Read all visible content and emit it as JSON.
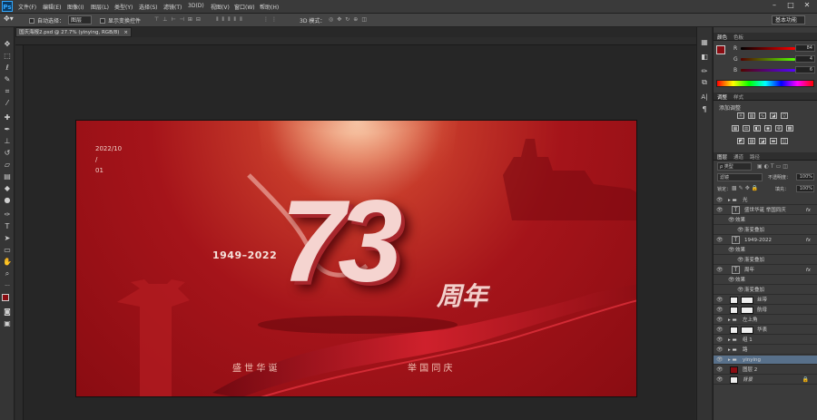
{
  "menubar": {
    "logo": "Ps",
    "items": [
      "文件(F)",
      "编辑(E)",
      "图像(I)",
      "图层(L)",
      "类型(Y)",
      "选择(S)",
      "滤镜(T)",
      "3D(D)",
      "视图(V)",
      "窗口(W)",
      "帮助(H)"
    ],
    "window_buttons": [
      "–",
      "□",
      "✕"
    ]
  },
  "optionsbar": {
    "auto_select_label": "自动选择：",
    "auto_select_value": "图层",
    "show_transform_label": "显示变换控件",
    "mode_3d_label": "3D 模式：",
    "workspace": "基本功能"
  },
  "document": {
    "tab_title": "国庆海报2.psd @ 27.7% (yinying, RGB/8)",
    "close": "×"
  },
  "poster": {
    "date_line1": "2022/10",
    "date_line2": "/",
    "date_line3": "01",
    "years": "1949–2022",
    "big_number": "73",
    "suffix": "周年",
    "slogan_left": "盛 世 华 诞",
    "slogan_right": "举 国 同 庆"
  },
  "color_panel": {
    "tab_active": "颜色",
    "tab_other": "色板",
    "r_label": "R",
    "r_value": "84",
    "g_label": "G",
    "g_value": "4",
    "b_label": "B",
    "b_value": "6"
  },
  "adjust_panel": {
    "tab_active": "调整",
    "tab_other": "样式",
    "title": "添加调整"
  },
  "layers_panel": {
    "tabs": [
      "图层",
      "通道",
      "路径"
    ],
    "filter_label": "ρ 类型",
    "blend_mode": "滤镜",
    "opacity_label": "不透明度：",
    "opacity_value": "100%",
    "lock_label": "锁定：",
    "fill_label": "填充：",
    "fill_value": "100%",
    "layers": [
      {
        "name": "光",
        "type": "folder",
        "fx": false,
        "sel": false
      },
      {
        "name": "盛世华诞 举国同庆",
        "type": "text",
        "fx": true,
        "sel": false
      },
      {
        "name": "效果",
        "type": "sub",
        "fx": false,
        "sel": false
      },
      {
        "name": "渐变叠加",
        "type": "sub2",
        "fx": false,
        "sel": false
      },
      {
        "name": "1949-2022",
        "type": "text",
        "fx": true,
        "sel": false
      },
      {
        "name": "效果",
        "type": "sub",
        "fx": false,
        "sel": false
      },
      {
        "name": "渐变叠加",
        "type": "sub2",
        "fx": false,
        "sel": false
      },
      {
        "name": "周年",
        "type": "text",
        "fx": true,
        "sel": false
      },
      {
        "name": "效果",
        "type": "sub",
        "fx": false,
        "sel": false
      },
      {
        "name": "渐变叠加",
        "type": "sub2",
        "fx": false,
        "sel": false
      },
      {
        "name": "丝带",
        "type": "pix",
        "fx": false,
        "sel": false
      },
      {
        "name": "航母",
        "type": "pix",
        "fx": false,
        "sel": false
      },
      {
        "name": "左上角",
        "type": "folder",
        "fx": false,
        "sel": false
      },
      {
        "name": "华表",
        "type": "pix",
        "fx": false,
        "sel": false
      },
      {
        "name": "组 1",
        "type": "folder",
        "fx": false,
        "sel": false
      },
      {
        "name": "路",
        "type": "folder",
        "fx": false,
        "sel": false
      },
      {
        "name": "yinying",
        "type": "folder",
        "fx": false,
        "sel": true
      },
      {
        "name": "图层 2",
        "type": "red",
        "fx": false,
        "sel": false
      },
      {
        "name": "背景",
        "type": "bg",
        "fx": false,
        "sel": false
      }
    ]
  },
  "colors": {
    "foreground": "#8a0c12",
    "background": "#ffffff",
    "accent": "#58708a"
  }
}
